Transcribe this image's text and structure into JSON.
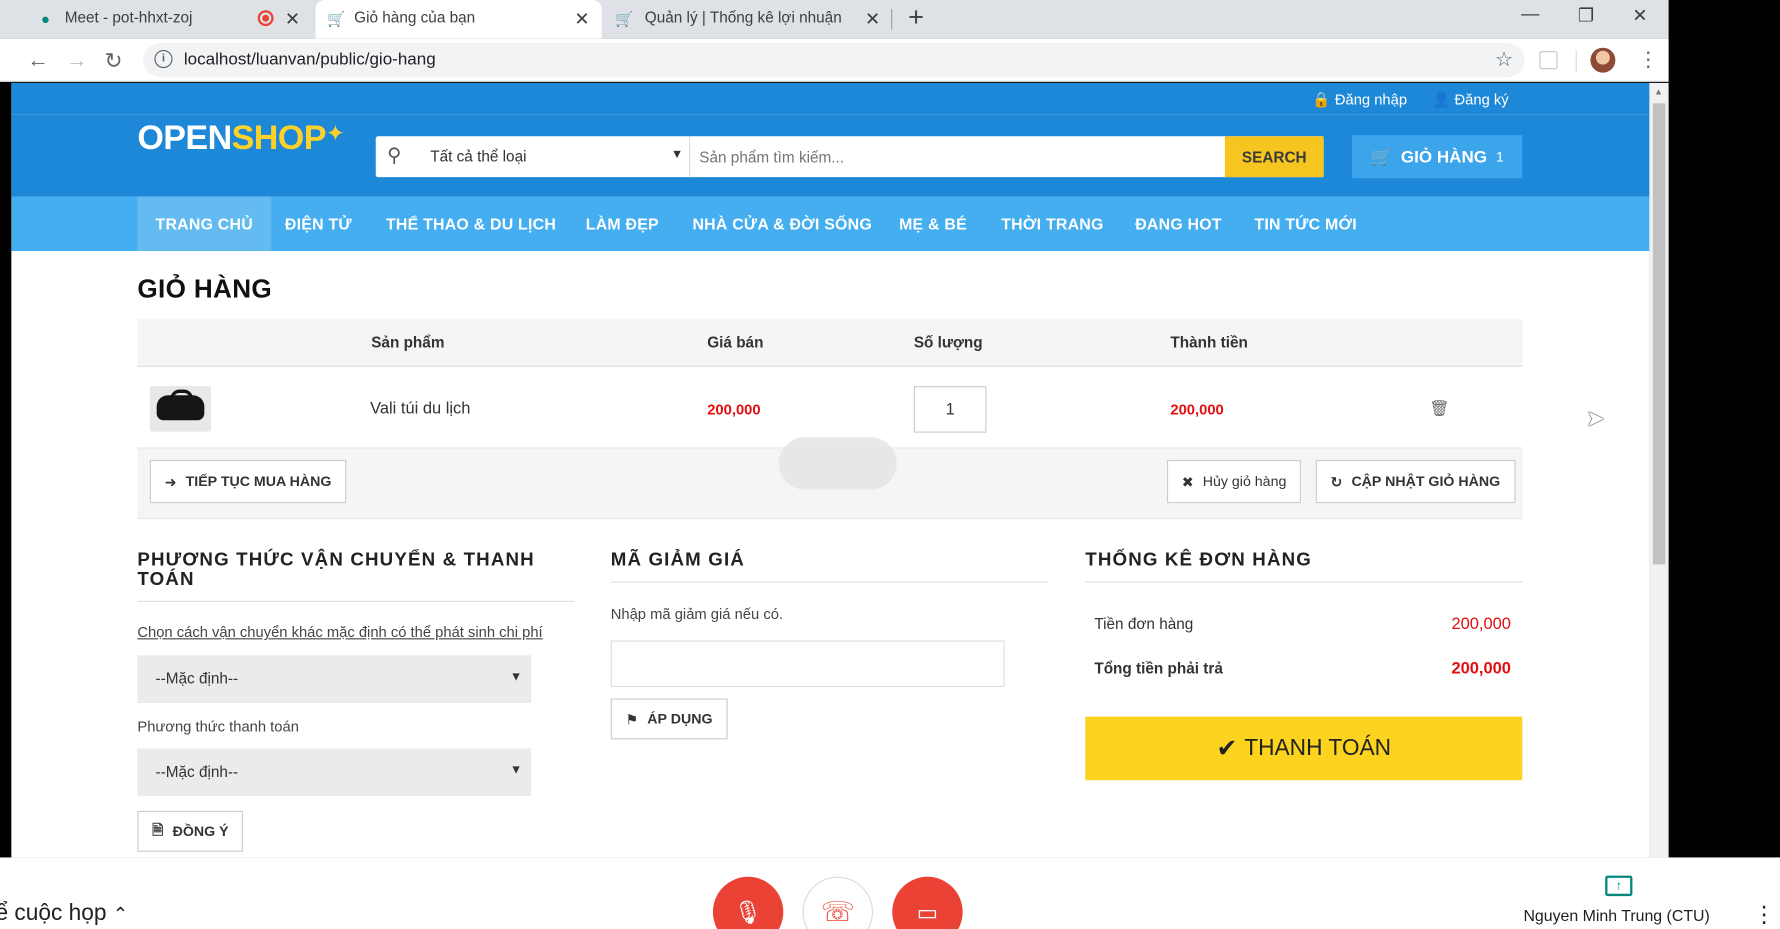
{
  "browser": {
    "tabs": [
      {
        "title": "Meet - pot-hhxt-zoj",
        "icon": "meet-icon"
      },
      {
        "title": "Giỏ hàng của bạn",
        "icon": "cart-favicon"
      },
      {
        "title": "Quản lý | Thống kê lợi nhuận",
        "icon": "cart-favicon"
      }
    ],
    "new_tab": "+",
    "url": "localhost/luanvan/public/gio-hang"
  },
  "topbar": {
    "login": "Đăng nhập",
    "register": "Đăng ký"
  },
  "header": {
    "logo_open": "OPEN",
    "logo_shop": "SHOP",
    "category": "Tất cả thể loại",
    "search_placeholder": "Sản phẩm tìm kiếm...",
    "search_button": "SEARCH",
    "cart_label": "GIỎ HÀNG",
    "cart_count": "1"
  },
  "nav": [
    "TRANG CHỦ",
    "ĐIỆN TỬ",
    "THỂ THAO & DU LỊCH",
    "LÀM ĐẸP",
    "NHÀ CỬA & ĐỜI SỐNG",
    "MẸ & BÉ",
    "THỜI TRANG",
    "ĐANG HOT",
    "TIN TỨC MỚI"
  ],
  "cart": {
    "title": "GIỎ HÀNG",
    "columns": [
      "Sản phẩm",
      "Giá bán",
      "Số lượng",
      "Thành tiền"
    ],
    "items": [
      {
        "name": "Vali túi du lịch",
        "price": "200,000",
        "qty": "1",
        "total": "200,000"
      }
    ],
    "continue_button": "TIẾP TỤC MUA HÀNG",
    "clear_button": "Hủy giỏ hàng",
    "update_button": "CẬP NHẬT GIỎ HÀNG"
  },
  "shipping": {
    "heading": "PHƯƠNG THỨC VẬN CHUYỂN & THANH TOÁN",
    "link": "Chọn cách vận chuyển khác mặc định có thể phát sinh chi phí",
    "shipping_select": "--Mặc định--",
    "payment_label": "Phương thức thanh toán",
    "payment_select": "--Mặc định--",
    "confirm_button": "ĐỒNG Ý"
  },
  "coupon": {
    "heading": "MÃ GIẢM GIÁ",
    "hint": "Nhập mã giảm giá nếu có.",
    "apply_button": "ÁP DỤNG"
  },
  "summary": {
    "heading": "THỐNG KÊ ĐƠN HÀNG",
    "subtotal_label": "Tiền đơn hàng",
    "subtotal_value": "200,000",
    "total_label": "Tổng tiền phải trả",
    "total_value": "200,000",
    "checkout_button": "THANH TOÁN"
  },
  "meet": {
    "details": "ể cuộc họp",
    "presenter": "Nguyen Minh Trung (CTU)"
  },
  "colors": {
    "brand_blue": "#1e88d8",
    "nav_blue": "#44aef0",
    "accent_yellow": "#fcd31e",
    "price_red": "#e01010",
    "meet_red": "#ea4335"
  }
}
